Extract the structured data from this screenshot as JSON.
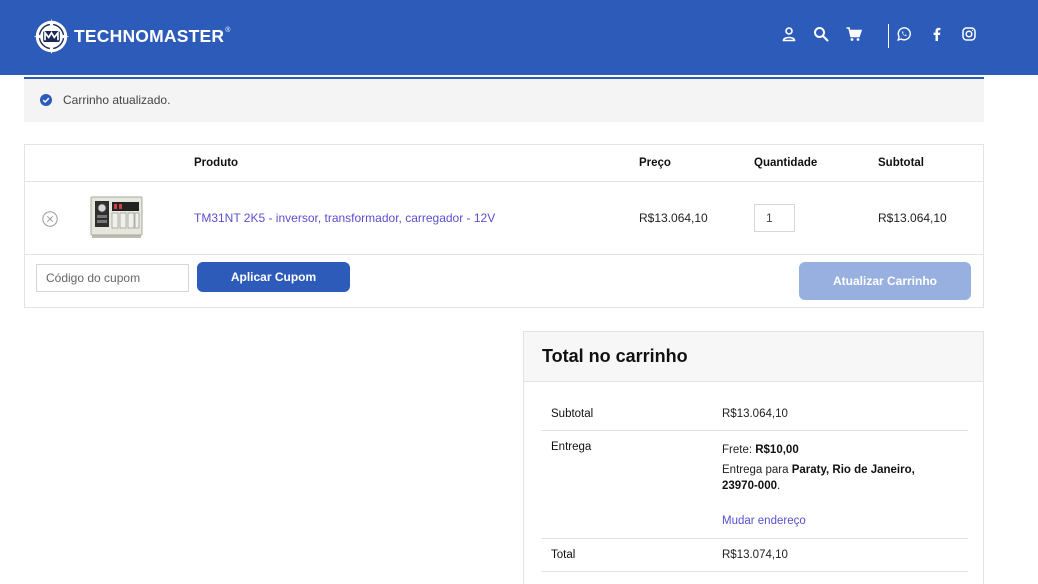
{
  "header": {
    "brand": "TECHNOMASTER",
    "brand_mark": "®",
    "icons": [
      "user-icon",
      "search-icon",
      "cart-icon",
      "whatsapp-icon",
      "facebook-icon",
      "instagram-icon"
    ],
    "background": "#2d5bba"
  },
  "notice": {
    "text": "Carrinho atualizado.",
    "icon": "check-circle-icon"
  },
  "cart": {
    "headers": {
      "product": "Produto",
      "price": "Preço",
      "quantity": "Quantidade",
      "subtotal": "Subtotal"
    },
    "items": [
      {
        "name": "TM31NT 2K5 - inversor, transformador, carregador - 12V",
        "price": "R$13.064,10",
        "quantity": "1",
        "subtotal": "R$13.064,10"
      }
    ],
    "coupon_placeholder": "Código do cupom",
    "apply_coupon_label": "Aplicar Cupom",
    "update_cart_label": "Atualizar Carrinho"
  },
  "totals": {
    "title": "Total no carrinho",
    "subtotal_label": "Subtotal",
    "subtotal_value": "R$13.064,10",
    "shipping_label": "Entrega",
    "shipping_freight_prefix": "Frete: ",
    "shipping_freight_value": "R$10,00",
    "shipping_to_prefix": "Entrega para ",
    "shipping_to_city": "Paraty, Rio de Janeiro,",
    "shipping_to_zip": "23970-000",
    "shipping_to_suffix": ".",
    "change_address": "Mudar endereço",
    "total_label": "Total",
    "total_value": "R$13.074,10"
  },
  "colors": {
    "accent": "#2d5bba",
    "link": "#5a4fcf",
    "disabled_button": "#98b0e0"
  }
}
